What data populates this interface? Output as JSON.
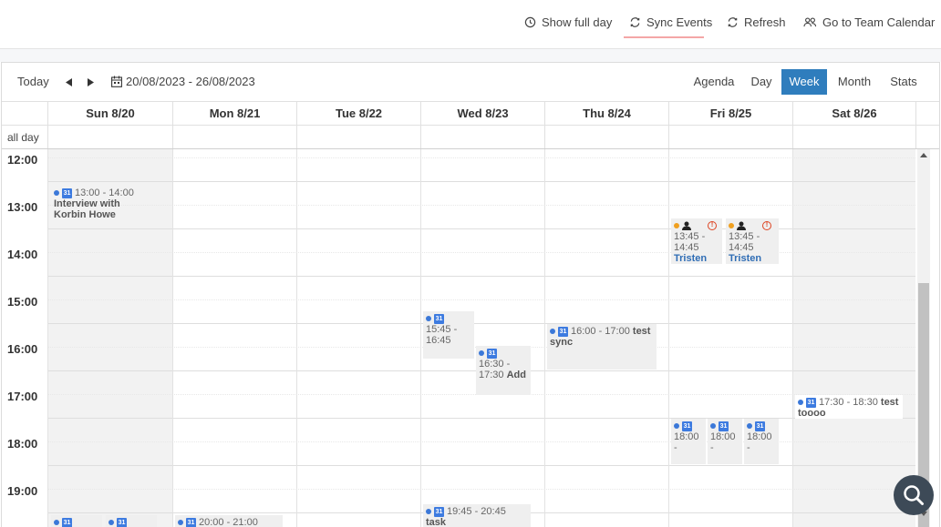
{
  "topbar": {
    "show_full_day": "Show full day",
    "sync_events": "Sync Events",
    "refresh": "Refresh",
    "team_calendar": "Go to Team Calendar"
  },
  "toolbar": {
    "today": "Today",
    "date_range": "20/08/2023 - 26/08/2023",
    "views": [
      "Agenda",
      "Day",
      "Week",
      "Month",
      "Stats"
    ],
    "active_view": "Week"
  },
  "days": [
    "Sun 8/20",
    "Mon 8/21",
    "Tue 8/22",
    "Wed 8/23",
    "Thu 8/24",
    "Fri 8/25",
    "Sat 8/26"
  ],
  "allday_label": "all day",
  "hours": [
    "12:00",
    "13:00",
    "14:00",
    "15:00",
    "16:00",
    "17:00",
    "18:00",
    "19:00"
  ],
  "events": {
    "sun_interview": {
      "time": "13:00 - 14:00",
      "title": "Interview with Korbin Howe"
    },
    "fri_tristen_1": {
      "time": "13:45 - 14:45",
      "title": "Tristen"
    },
    "fri_tristen_2": {
      "time": "13:45 - 14:45",
      "title": "Tristen"
    },
    "wed_1545": {
      "time": "15:45 - 16:45",
      "title": ""
    },
    "thu_test_sync": {
      "time": "16:00 - 17:00",
      "title": "test sync"
    },
    "wed_add": {
      "time": "16:30 - 17:30",
      "title": "Add"
    },
    "sat_toooo": {
      "time": "17:30 - 18:30",
      "title": "test toooo"
    },
    "fri_1800_a": {
      "time": "18:00 -",
      "title": ""
    },
    "fri_1800_b": {
      "time": "18:00 -",
      "title": ""
    },
    "fri_1800_c": {
      "time": "18:00 -",
      "title": ""
    },
    "wed_task": {
      "time": "19:45 - 20:45",
      "title": "task"
    },
    "mon_2000": {
      "time": "20:00 - 21:00",
      "title": ""
    }
  },
  "colors": {
    "accent": "#2f7dbd",
    "google": "#3d7be0",
    "warn": "#f0a020",
    "alert": "#dd4422"
  }
}
